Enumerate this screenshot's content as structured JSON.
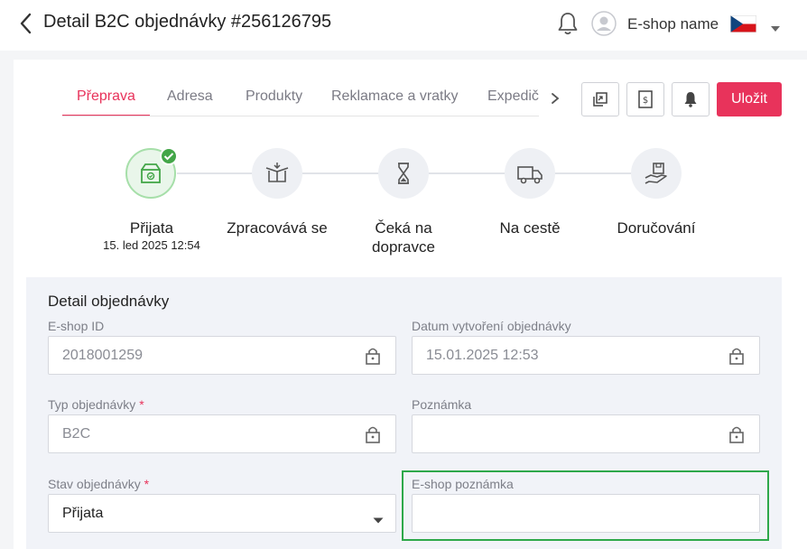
{
  "header": {
    "title": "Detail B2C objednávky #256126795",
    "shop_name": "E-shop name",
    "icons": [
      "back-arrow-icon",
      "bell-icon",
      "user-avatar-icon",
      "czech-flag-icon",
      "chevron-down-icon"
    ]
  },
  "tabs": {
    "items": [
      {
        "label": "Přeprava",
        "active": true
      },
      {
        "label": "Adresa",
        "active": false
      },
      {
        "label": "Produkty",
        "active": false
      },
      {
        "label": "Reklamace a vratky",
        "active": false
      },
      {
        "label": "Expedič",
        "active": false
      }
    ]
  },
  "toolbar": {
    "save_label": "Uložit"
  },
  "stepper": {
    "steps": [
      {
        "label": "Přijata",
        "date": "15. led 2025 12:54",
        "done": true,
        "icon": "box-icon"
      },
      {
        "label": "Zpracovává se",
        "date": "",
        "done": false,
        "icon": "open-box-icon"
      },
      {
        "label": "Čeká na dopravce",
        "date": "",
        "done": false,
        "icon": "hourglass-icon"
      },
      {
        "label": "Na cestě",
        "date": "",
        "done": false,
        "icon": "truck-icon"
      },
      {
        "label": "Doručování",
        "date": "",
        "done": false,
        "icon": "hand-package-icon"
      }
    ]
  },
  "detail": {
    "title": "Detail objednávky",
    "eshop_id": {
      "label": "E-shop ID",
      "value": "2018001259"
    },
    "created": {
      "label": "Datum vytvoření objednávky",
      "value": "15.01.2025 12:53"
    },
    "order_type": {
      "label": "Typ objednávky",
      "required_mark": "*",
      "value": "B2C"
    },
    "note": {
      "label": "Poznámka",
      "value": ""
    },
    "order_state": {
      "label": "Stav objednávky",
      "required_mark": "*",
      "value": "Přijata"
    },
    "eshop_note": {
      "label": "E-shop poznámka",
      "value": ""
    }
  },
  "colors": {
    "accent": "#e8335b",
    "success": "#43a648",
    "highlight": "#2ea84a",
    "panel": "#f1f3f8"
  }
}
